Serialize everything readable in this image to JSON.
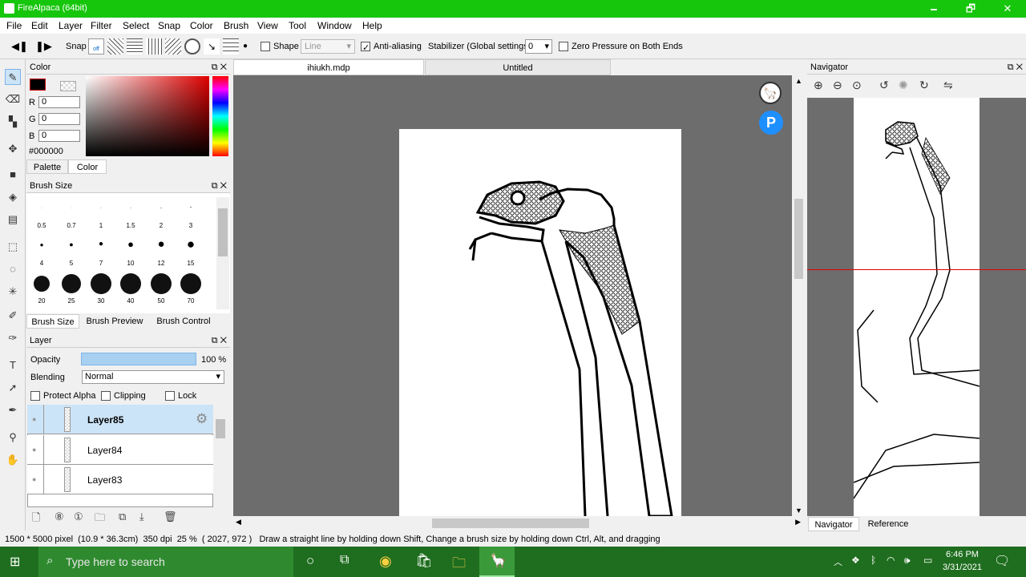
{
  "window": {
    "title": "FireAlpaca (64bit)",
    "minimize": "🗕",
    "maximize": "🗗",
    "close": "✕"
  },
  "menu": [
    "File",
    "Edit",
    "Layer",
    "Filter",
    "Select",
    "Snap",
    "Color",
    "Brush",
    "View",
    "Tool",
    "Window",
    "Help"
  ],
  "toolbar": {
    "snap_label": "Snap",
    "snap_off": "off",
    "shape_label": "Shape",
    "shape_value": "Line",
    "antialias_label": "Anti-aliasing",
    "stabilizer_label": "Stabilizer (Global settings)",
    "stabilizer_value": "0",
    "zero_pressure_label": "Zero Pressure on Both Ends"
  },
  "color_panel": {
    "title": "Color",
    "r_label": "R",
    "r": "0",
    "g_label": "G",
    "g": "0",
    "b_label": "B",
    "b": "0",
    "hex": "#000000",
    "tabs": [
      "Palette",
      "Color"
    ]
  },
  "brush_size_panel": {
    "title": "Brush Size",
    "sizes": [
      "0.5",
      "0.7",
      "1",
      "1.5",
      "2",
      "3",
      "4",
      "5",
      "7",
      "10",
      "12",
      "15",
      "20",
      "25",
      "30",
      "40",
      "50",
      "70"
    ],
    "tabs": [
      "Brush Size",
      "Brush Preview",
      "Brush Control"
    ]
  },
  "layer_panel": {
    "title": "Layer",
    "opacity_label": "Opacity",
    "opacity_value": "100 %",
    "opacity": 1.0,
    "blending_label": "Blending",
    "blending_value": "Normal",
    "protect_alpha": "Protect Alpha",
    "clipping": "Clipping",
    "lock": "Lock",
    "layers": [
      "Layer85",
      "Layer84",
      "Layer83"
    ]
  },
  "doc_tabs": [
    "ihiukh.mdp",
    "Untitled"
  ],
  "navigator": {
    "title": "Navigator",
    "tabs": [
      "Navigator",
      "Reference"
    ]
  },
  "status": {
    "size": "1500 * 5000 pixel",
    "cm": "(10.9 * 36.3cm)",
    "dpi": "350 dpi",
    "zoom": "25 %",
    "coords": "( 2027, 972 )",
    "hint": "Draw a straight line by holding down Shift, Change a brush size by holding down Ctrl, Alt, and dragging"
  },
  "taskbar": {
    "search_placeholder": "Type here to search",
    "time": "6:46 PM",
    "date": "3/31/2021"
  },
  "colors": {
    "titlebar": "#16c60c",
    "taskbar": "#1f6e1f",
    "canvas_bg": "#6d6d6d",
    "selected": "#cce4f7"
  }
}
